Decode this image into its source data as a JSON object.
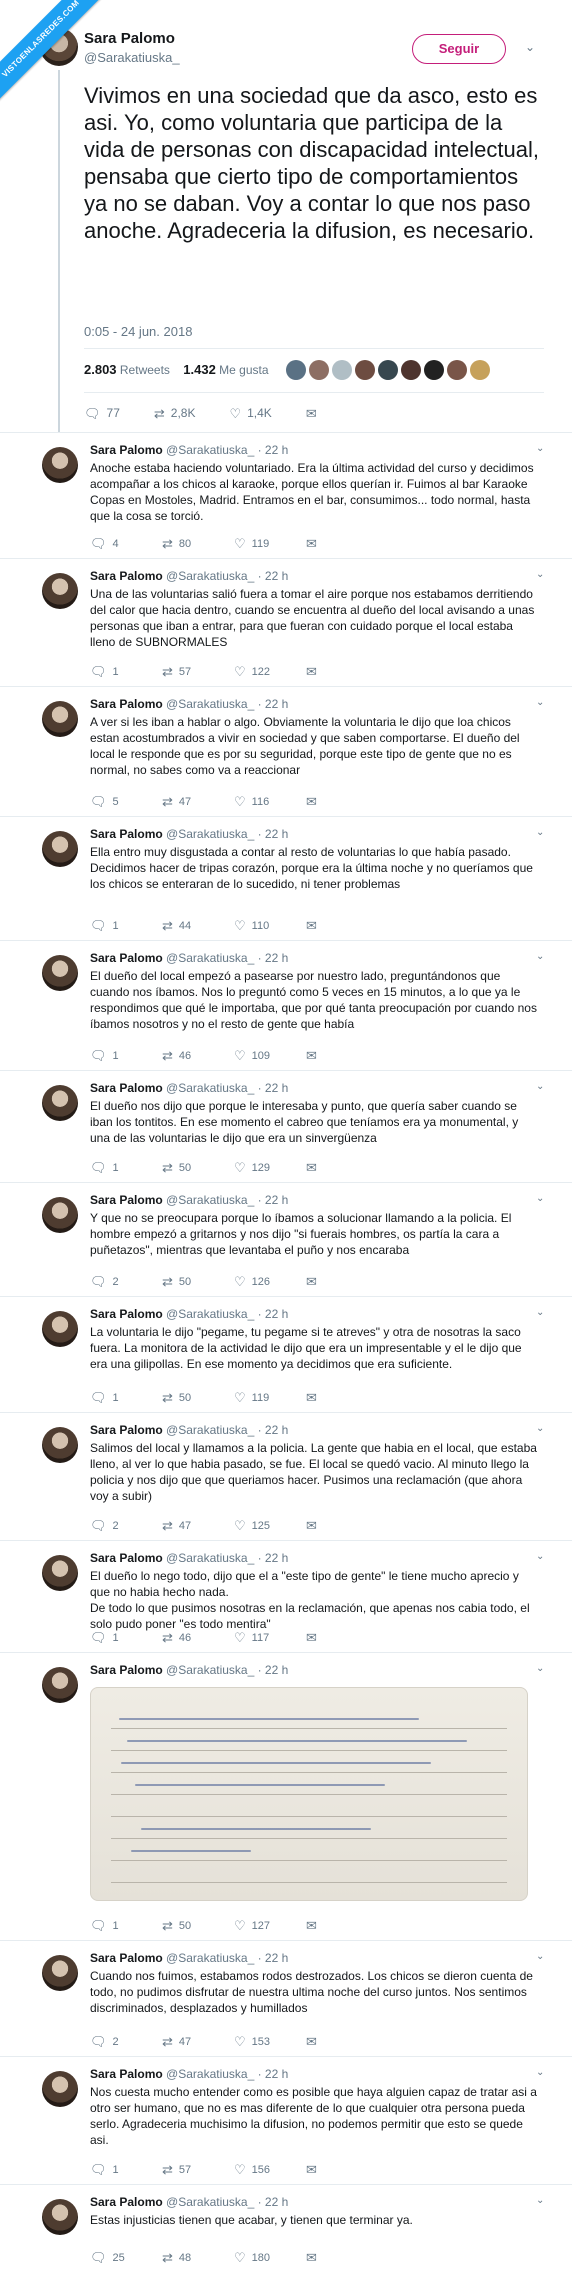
{
  "watermark": "VISTOENLASREDES.COM",
  "main_tweet": {
    "name": "Sara Palomo",
    "handle": "@Sarakatiuska_",
    "follow_label": "Seguir",
    "text": "Vivimos en una sociedad que da asco, esto es asi. Yo, como voluntaria que participa de la vida de personas con discapacidad intelectual, pensaba que cierto tipo de comportamientos ya no se daban. Voy a contar lo que nos paso anoche. Agradeceria la difusion, es necesario.",
    "timestamp": "0:05 - 24 jun. 2018",
    "retweets_count": "2.803",
    "retweets_label": "Retweets",
    "likes_count": "1.432",
    "likes_label": "Me gusta",
    "actions": {
      "replies": "77",
      "retweets": "2,8K",
      "likes": "1,4K"
    }
  },
  "replies": [
    {
      "name": "Sara Palomo",
      "meta": "@Sarakatiuska_ · 22 h",
      "text": "Anoche estaba haciendo voluntariado. Era la última actividad del curso y decidimos acompañar a los chicos al karaoke, porque ellos querían ir. Fuimos al bar Karaoke Copas en Mostoles, Madrid. Entramos en el bar, consumimos... todo normal, hasta que la cosa se torció.",
      "replies": "4",
      "retweets": "80",
      "likes": "119"
    },
    {
      "name": "Sara Palomo",
      "meta": "@Sarakatiuska_ · 22 h",
      "text": "Una de las voluntarias salió fuera a tomar el aire porque nos estabamos derritiendo del calor que hacia dentro, cuando se encuentra al dueño del local avisando a unas personas que iban a entrar, para que fueran con cuidado porque el local estaba lleno de SUBNORMALES",
      "replies": "1",
      "retweets": "57",
      "likes": "122"
    },
    {
      "name": "Sara Palomo",
      "meta": "@Sarakatiuska_ · 22 h",
      "text": "A ver si les iban a hablar o algo. Obviamente la voluntaria le dijo que loa chicos estan acostumbrados a vivir en sociedad y que saben comportarse. El dueño del local le responde que es por su seguridad, porque este tipo de gente que no es normal, no sabes como va a reaccionar",
      "replies": "5",
      "retweets": "47",
      "likes": "116"
    },
    {
      "name": "Sara Palomo",
      "meta": "@Sarakatiuska_ · 22 h",
      "text": "Ella entro muy disgustada a contar al resto de voluntarias lo que había pasado. Decidimos hacer de tripas corazón, porque era la última noche y no queríamos que los chicos se enteraran de lo sucedido, ni tener problemas",
      "replies": "1",
      "retweets": "44",
      "likes": "110"
    },
    {
      "name": "Sara Palomo",
      "meta": "@Sarakatiuska_ · 22 h",
      "text": "El dueño del local empezó a pasearse por nuestro lado, preguntándonos que cuando nos íbamos. Nos lo preguntó como 5 veces en 15 minutos, a lo que ya le respondimos que qué le importaba, que por qué tanta preocupación por cuando nos íbamos nosotros y no el resto de gente que había",
      "replies": "1",
      "retweets": "46",
      "likes": "109"
    },
    {
      "name": "Sara Palomo",
      "meta": "@Sarakatiuska_ · 22 h",
      "text": "El dueño nos dijo que porque le interesaba y punto, que quería saber cuando se iban los tontitos. En ese momento el cabreo que teníamos era ya monumental, y una de las voluntarias le dijo que era un sinvergüenza",
      "replies": "1",
      "retweets": "50",
      "likes": "129"
    },
    {
      "name": "Sara Palomo",
      "meta": "@Sarakatiuska_ · 22 h",
      "text": "Y que no se preocupara porque lo íbamos a solucionar llamando a la policia. El hombre empezó a gritarnos y nos dijo \"si fuerais hombres, os partía la cara a puñetazos\", mientras que levantaba el puño y nos encaraba",
      "replies": "2",
      "retweets": "50",
      "likes": "126"
    },
    {
      "name": "Sara Palomo",
      "meta": "@Sarakatiuska_ · 22 h",
      "text": "La voluntaria le dijo \"pegame, tu pegame si te atreves\" y otra de nosotras la saco fuera. La monitora de la actividad le dijo que era un impresentable y el le dijo que era una gilipollas. En ese momento ya decidimos que era suficiente.",
      "replies": "1",
      "retweets": "50",
      "likes": "119"
    },
    {
      "name": "Sara Palomo",
      "meta": "@Sarakatiuska_ · 22 h",
      "text": "Salimos del local y llamamos a la policia. La gente que habia en el local, que estaba lleno, al ver lo que habia pasado, se fue. El local se quedó vacio. Al minuto llego la policia y nos dijo que que queriamos hacer. Pusimos una reclamación (que ahora voy a subir)",
      "replies": "2",
      "retweets": "47",
      "likes": "125"
    },
    {
      "name": "Sara Palomo",
      "meta": "@Sarakatiuska_ · 22 h",
      "text": "El dueño lo nego todo, dijo que el a \"este tipo de gente\" le tiene mucho aprecio y que no habia hecho nada.\nDe todo lo que pusimos nosotras en la reclamación, que apenas nos cabia todo, el solo pudo poner \"es todo mentira\"",
      "replies": "1",
      "retweets": "46",
      "likes": "117"
    },
    {
      "name": "Sara Palomo",
      "meta": "@Sarakatiuska_ · 22 h",
      "text": "",
      "replies": "1",
      "retweets": "50",
      "likes": "127"
    },
    {
      "name": "Sara Palomo",
      "meta": "@Sarakatiuska_ · 22 h",
      "text": "Cuando nos fuimos, estabamos rodos destrozados. Los chicos se dieron cuenta de todo, no pudimos disfrutar de  nuestra ultima noche del curso juntos. Nos sentimos discriminados, desplazados y humillados",
      "replies": "2",
      "retweets": "47",
      "likes": "153"
    },
    {
      "name": "Sara Palomo",
      "meta": "@Sarakatiuska_ · 22 h",
      "text": "Nos cuesta mucho entender como es posible que haya alguien capaz de tratar asi a otro ser humano, que no es mas diferente de lo que cualquier otra persona pueda serlo. Agradeceria muchisimo la difusion, no podemos permitir que esto se quede asi.",
      "replies": "1",
      "retweets": "57",
      "likes": "156"
    },
    {
      "name": "Sara Palomo",
      "meta": "@Sarakatiuska_ · 22 h",
      "text": "Estas injusticias tienen que acabar, y tienen que terminar ya.",
      "replies": "25",
      "retweets": "48",
      "likes": "180"
    }
  ]
}
